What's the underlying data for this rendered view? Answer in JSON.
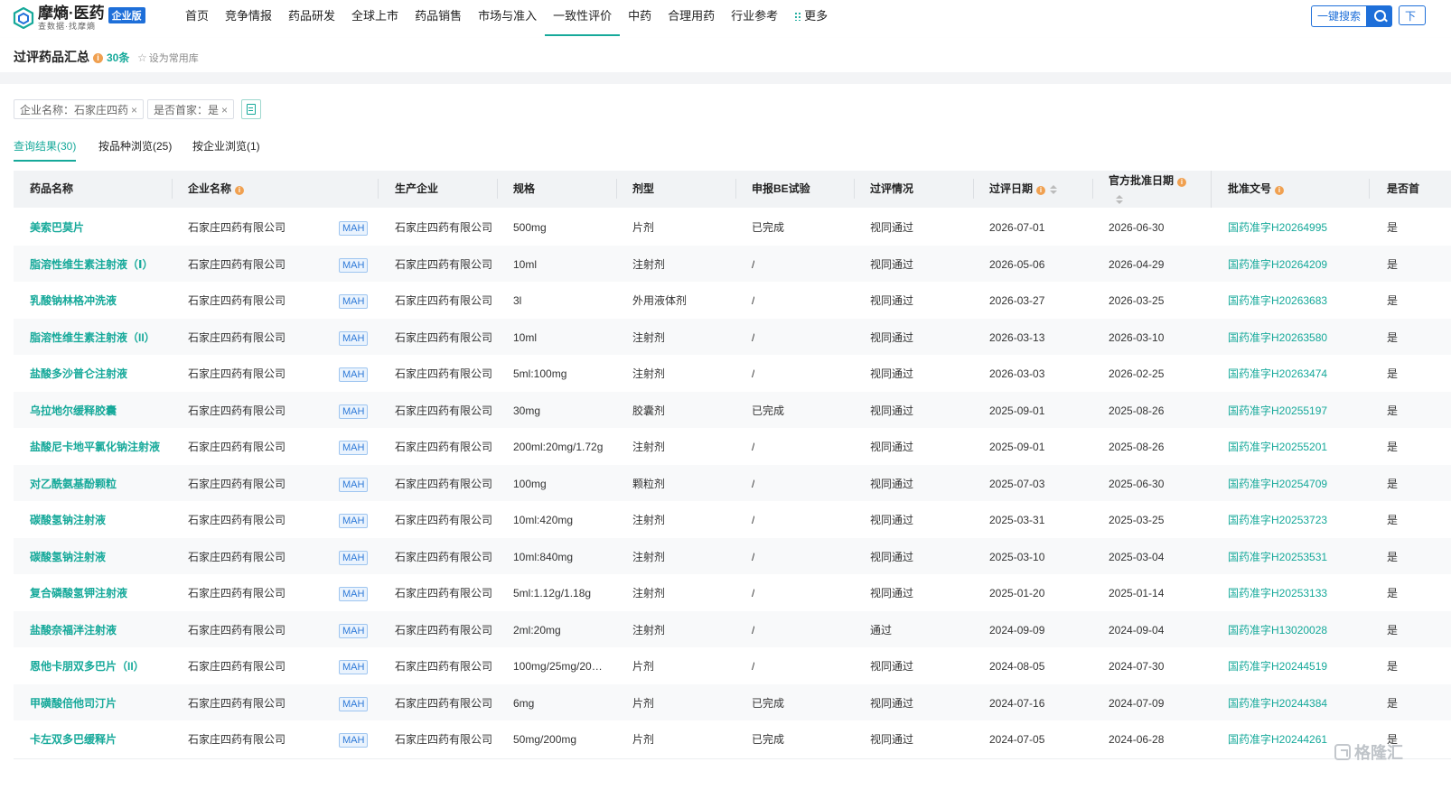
{
  "brand": {
    "name": "摩熵·医药",
    "tagline": "查数据·找摩熵",
    "edition": "企业版"
  },
  "nav": {
    "items": [
      "首页",
      "竞争情报",
      "药品研发",
      "全球上市",
      "药品销售",
      "市场与准入",
      "一致性评价",
      "中药",
      "合理用药",
      "行业参考"
    ],
    "active": "一致性评价",
    "more": "更多"
  },
  "search": {
    "button_label": "一键搜索",
    "download_label": "下"
  },
  "page": {
    "title": "过评药品汇总",
    "count": "30条",
    "favorite_label": "设为常用库",
    "info_icon": "i"
  },
  "filters": [
    {
      "label": "企业名称：石家庄四药",
      "close": "×"
    },
    {
      "label": "是否首家：是",
      "close": "×"
    }
  ],
  "result_tabs": [
    "查询结果(30)",
    "按品种浏览(25)",
    "按企业浏览(1)"
  ],
  "table": {
    "columns": [
      "药品名称",
      "企业名称",
      "生产企业",
      "规格",
      "剂型",
      "申报BE试验",
      "过评情况",
      "过评日期",
      "官方批准日期",
      "批准文号",
      "是否首"
    ],
    "tag": "MAH",
    "rows": [
      {
        "drug": "美索巴莫片",
        "company": "石家庄四药有限公司",
        "maker": "石家庄四药有限公司",
        "spec": "500mg",
        "form": "片剂",
        "be": "已完成",
        "status": "视同通过",
        "pass_date": "2026-07-01",
        "approve_date": "2026-06-30",
        "approval_no": "国药准字H20264995",
        "first": "是"
      },
      {
        "drug": "脂溶性维生素注射液（Ⅰ）",
        "company": "石家庄四药有限公司",
        "maker": "石家庄四药有限公司",
        "spec": "10ml",
        "form": "注射剂",
        "be": "/",
        "status": "视同通过",
        "pass_date": "2026-05-06",
        "approve_date": "2026-04-29",
        "approval_no": "国药准字H20264209",
        "first": "是"
      },
      {
        "drug": "乳酸钠林格冲洗液",
        "company": "石家庄四药有限公司",
        "maker": "石家庄四药有限公司",
        "spec": "3l",
        "form": "外用液体剂",
        "be": "/",
        "status": "视同通过",
        "pass_date": "2026-03-27",
        "approve_date": "2026-03-25",
        "approval_no": "国药准字H20263683",
        "first": "是"
      },
      {
        "drug": "脂溶性维生素注射液（II）",
        "company": "石家庄四药有限公司",
        "maker": "石家庄四药有限公司",
        "spec": "10ml",
        "form": "注射剂",
        "be": "/",
        "status": "视同通过",
        "pass_date": "2026-03-13",
        "approve_date": "2026-03-10",
        "approval_no": "国药准字H20263580",
        "first": "是"
      },
      {
        "drug": "盐酸多沙普仑注射液",
        "company": "石家庄四药有限公司",
        "maker": "石家庄四药有限公司",
        "spec": "5ml:100mg",
        "form": "注射剂",
        "be": "/",
        "status": "视同通过",
        "pass_date": "2026-03-03",
        "approve_date": "2026-02-25",
        "approval_no": "国药准字H20263474",
        "first": "是"
      },
      {
        "drug": "乌拉地尔缓释胶囊",
        "company": "石家庄四药有限公司",
        "maker": "石家庄四药有限公司",
        "spec": "30mg",
        "form": "胶囊剂",
        "be": "已完成",
        "status": "视同通过",
        "pass_date": "2025-09-01",
        "approve_date": "2025-08-26",
        "approval_no": "国药准字H20255197",
        "first": "是"
      },
      {
        "drug": "盐酸尼卡地平氯化钠注射液",
        "company": "石家庄四药有限公司",
        "maker": "石家庄四药有限公司",
        "spec": "200ml:20mg/1.72g",
        "form": "注射剂",
        "be": "/",
        "status": "视同通过",
        "pass_date": "2025-09-01",
        "approve_date": "2025-08-26",
        "approval_no": "国药准字H20255201",
        "first": "是"
      },
      {
        "drug": "对乙酰氨基酚颗粒",
        "company": "石家庄四药有限公司",
        "maker": "石家庄四药有限公司",
        "spec": "100mg",
        "form": "颗粒剂",
        "be": "/",
        "status": "视同通过",
        "pass_date": "2025-07-03",
        "approve_date": "2025-06-30",
        "approval_no": "国药准字H20254709",
        "first": "是"
      },
      {
        "drug": "碳酸氢钠注射液",
        "company": "石家庄四药有限公司",
        "maker": "石家庄四药有限公司",
        "spec": "10ml:420mg",
        "form": "注射剂",
        "be": "/",
        "status": "视同通过",
        "pass_date": "2025-03-31",
        "approve_date": "2025-03-25",
        "approval_no": "国药准字H20253723",
        "first": "是"
      },
      {
        "drug": "碳酸氢钠注射液",
        "company": "石家庄四药有限公司",
        "maker": "石家庄四药有限公司",
        "spec": "10ml:840mg",
        "form": "注射剂",
        "be": "/",
        "status": "视同通过",
        "pass_date": "2025-03-10",
        "approve_date": "2025-03-04",
        "approval_no": "国药准字H20253531",
        "first": "是"
      },
      {
        "drug": "复合磷酸氢钾注射液",
        "company": "石家庄四药有限公司",
        "maker": "石家庄四药有限公司",
        "spec": "5ml:1.12g/1.18g",
        "form": "注射剂",
        "be": "/",
        "status": "视同通过",
        "pass_date": "2025-01-20",
        "approve_date": "2025-01-14",
        "approval_no": "国药准字H20253133",
        "first": "是"
      },
      {
        "drug": "盐酸奈福泮注射液",
        "company": "石家庄四药有限公司",
        "maker": "石家庄四药有限公司",
        "spec": "2ml:20mg",
        "form": "注射剂",
        "be": "/",
        "status": "通过",
        "pass_date": "2024-09-09",
        "approve_date": "2024-09-04",
        "approval_no": "国药准字H13020028",
        "first": "是"
      },
      {
        "drug": "恩他卡朋双多巴片（II）",
        "company": "石家庄四药有限公司",
        "maker": "石家庄四药有限公司",
        "spec": "100mg/25mg/20…",
        "form": "片剂",
        "be": "/",
        "status": "视同通过",
        "pass_date": "2024-08-05",
        "approve_date": "2024-07-30",
        "approval_no": "国药准字H20244519",
        "first": "是"
      },
      {
        "drug": "甲磺酸倍他司汀片",
        "company": "石家庄四药有限公司",
        "maker": "石家庄四药有限公司",
        "spec": "6mg",
        "form": "片剂",
        "be": "已完成",
        "status": "视同通过",
        "pass_date": "2024-07-16",
        "approve_date": "2024-07-09",
        "approval_no": "国药准字H20244384",
        "first": "是"
      },
      {
        "drug": "卡左双多巴缓释片",
        "company": "石家庄四药有限公司",
        "maker": "石家庄四药有限公司",
        "spec": "50mg/200mg",
        "form": "片剂",
        "be": "已完成",
        "status": "视同通过",
        "pass_date": "2024-07-05",
        "approve_date": "2024-06-28",
        "approval_no": "国药准字H20244261",
        "first": "是"
      }
    ]
  },
  "watermark": "格隆汇",
  "colors": {
    "accent": "#16a99a",
    "brand_blue": "#1e6fd9",
    "warning": "#f0a050"
  }
}
